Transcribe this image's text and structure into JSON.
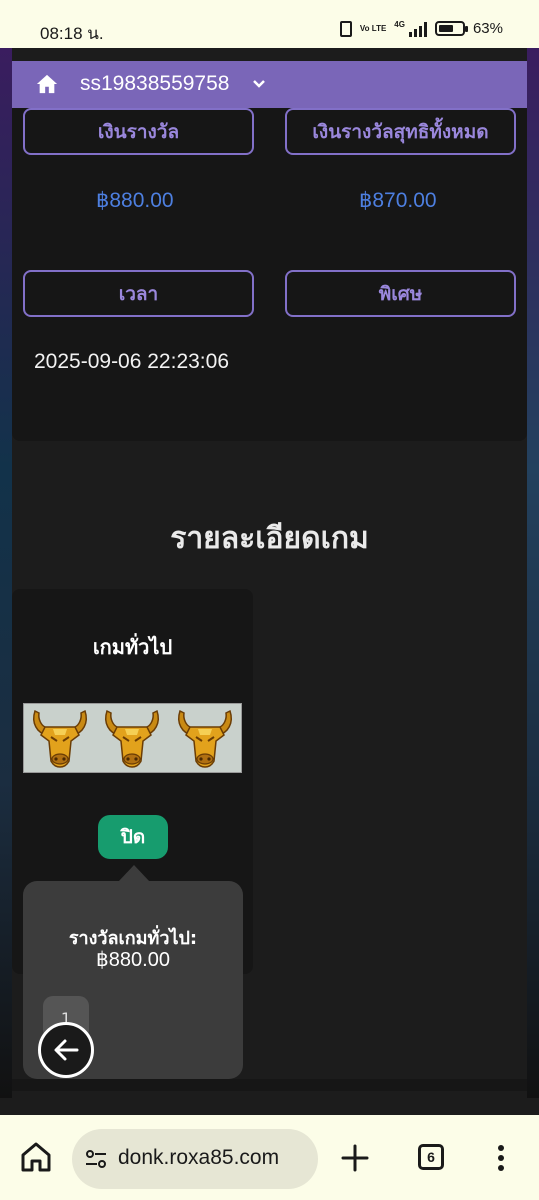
{
  "status_bar": {
    "time": "08:18 น.",
    "network": "4G",
    "volte": "Vo LTE",
    "battery": "63%",
    "battery_level": 0.63
  },
  "header": {
    "account": "ss19838559758",
    "icons": [
      "home-icon",
      "chevron-down-icon"
    ]
  },
  "result": {
    "win_label": "เงินรางวัล",
    "net_win_label": "เงินรางวัลสุทธิทั้งหมด",
    "win_value": "฿880.00",
    "net_win_value": "฿870.00",
    "time_label": "เวลา",
    "special_label": "พิเศษ",
    "time_value": "2025-09-06 22:23:06"
  },
  "game_details": {
    "title": "รายละเอียดเกม",
    "game_type": "เกมทั่วไป",
    "reel_symbols": [
      "bull-icon",
      "bull-icon",
      "bull-icon"
    ],
    "close_label": "ปิด"
  },
  "popover": {
    "label": "รางวัลเกมทั่วไป:",
    "value": "฿880.00",
    "page": "1"
  },
  "browser": {
    "url": "donk.roxa85.com",
    "tab_count": "6"
  },
  "colors": {
    "header": "#7a66b8",
    "accent_border": "#8270c8",
    "money": "#4d7fe0",
    "close_button": "#179c6e",
    "browser_bar": "#fcfde8"
  }
}
